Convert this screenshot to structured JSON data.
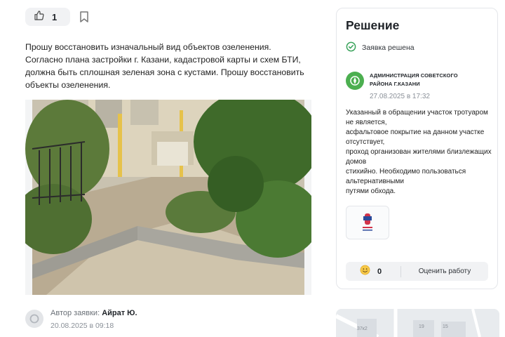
{
  "like": {
    "count": "1"
  },
  "description": "Прошу восстановить изначальный вид объектов озеленения. Согласно плана застройки г. Казани, кадастровой карты и схем БТИ, должна быть сплошная зеленая зона с кустами. Прошу восстановить объекты озеленения.",
  "author": {
    "label": "Автор заявки:",
    "name": "Айрат Ю.",
    "date": "20.08.2025 в 09:18"
  },
  "solution": {
    "title": "Решение",
    "status": "Заявка решена",
    "org_name": "АДМИНИСТРАЦИЯ СОВЕТСКОГО РАЙОНА Г.КАЗАНИ",
    "org_date": "27.08.2025 в 17:32",
    "answer": "Указанный в обращении участок тротуаром не является,\nасфальтовое покрытие на данном участке отсутствует,\nпроход организован жителями близлежащих домов\nстихийно. Необходимо пользоваться альтернативными\nпутями обхода.",
    "rating_count": "0",
    "rate_button": "Оценить работу"
  },
  "map": {
    "labels": [
      "37к2",
      "19",
      "15"
    ]
  },
  "colors": {
    "accent_green": "#4caf50",
    "status_green": "#3aa35b"
  }
}
